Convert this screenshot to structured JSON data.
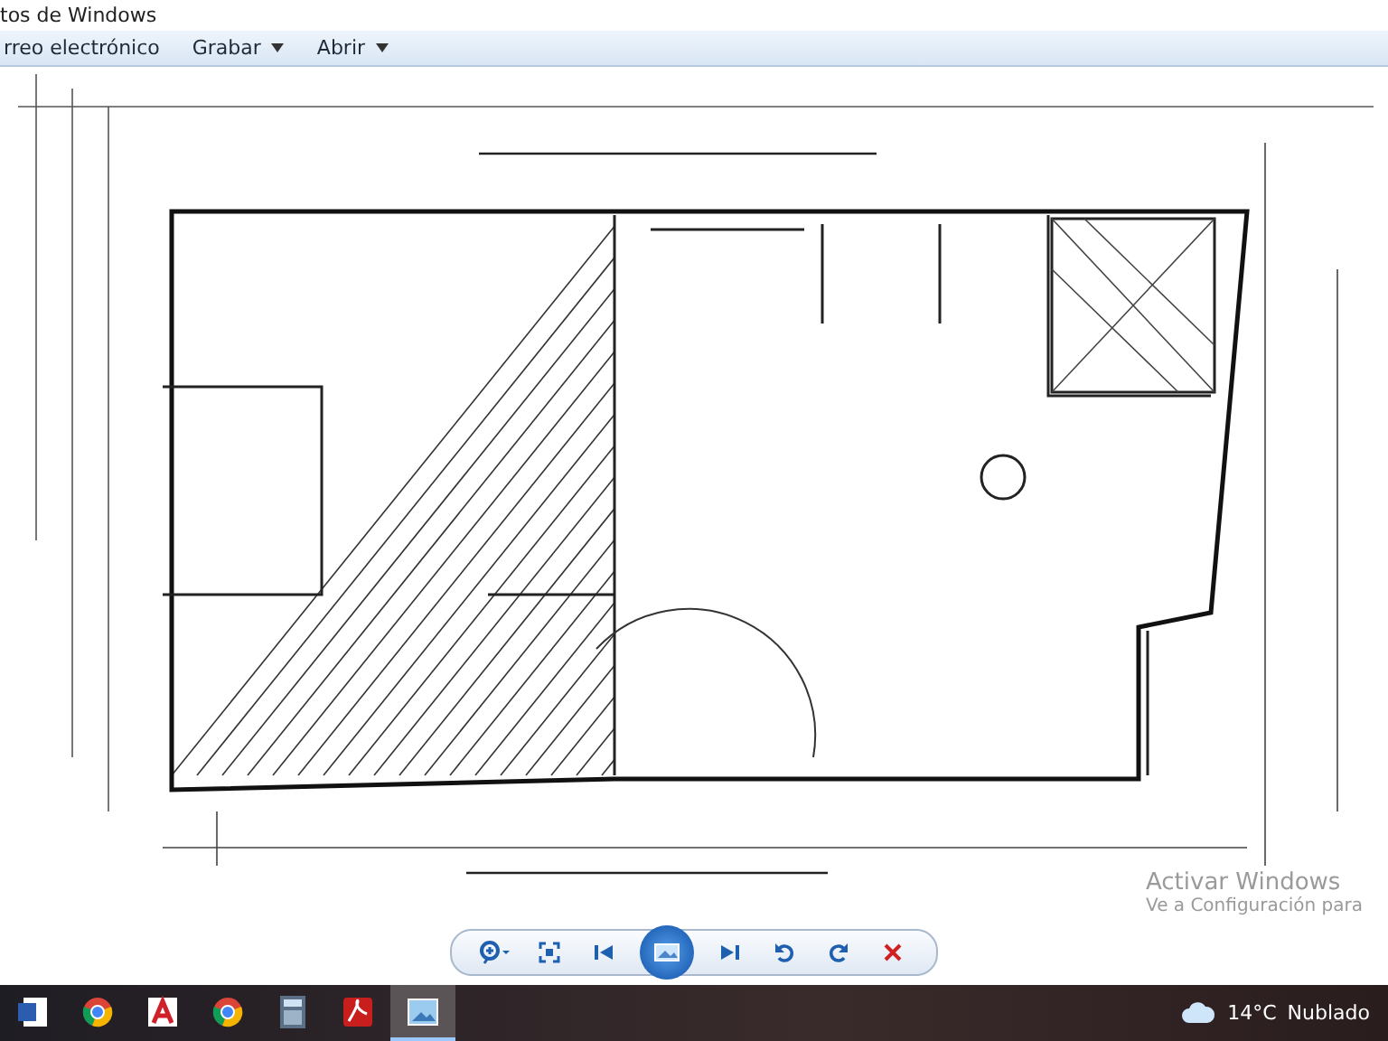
{
  "window": {
    "title": "tos de Windows"
  },
  "menu": [
    {
      "label": "rreo electrónico",
      "dropdown": false
    },
    {
      "label": "Grabar",
      "dropdown": true
    },
    {
      "label": "Abrir",
      "dropdown": true
    }
  ],
  "activation": {
    "title": "Activar Windows",
    "subtitle": "Ve a Configuración para"
  },
  "controls": [
    {
      "kind": "zoom"
    },
    {
      "kind": "fit"
    },
    {
      "kind": "prev"
    },
    {
      "kind": "slideshow"
    },
    {
      "kind": "next"
    },
    {
      "kind": "rotate-left"
    },
    {
      "kind": "rotate-right"
    },
    {
      "kind": "delete"
    }
  ],
  "taskbar": {
    "apps": [
      {
        "kind": "word",
        "active": false
      },
      {
        "kind": "browser",
        "active": false
      },
      {
        "kind": "cad",
        "active": false
      },
      {
        "kind": "browser",
        "active": false
      },
      {
        "kind": "calculator",
        "active": false
      },
      {
        "kind": "pdf",
        "active": false
      },
      {
        "kind": "photos",
        "active": true
      }
    ],
    "weather": {
      "temperature": "14°C",
      "condition": "Nublado"
    }
  }
}
